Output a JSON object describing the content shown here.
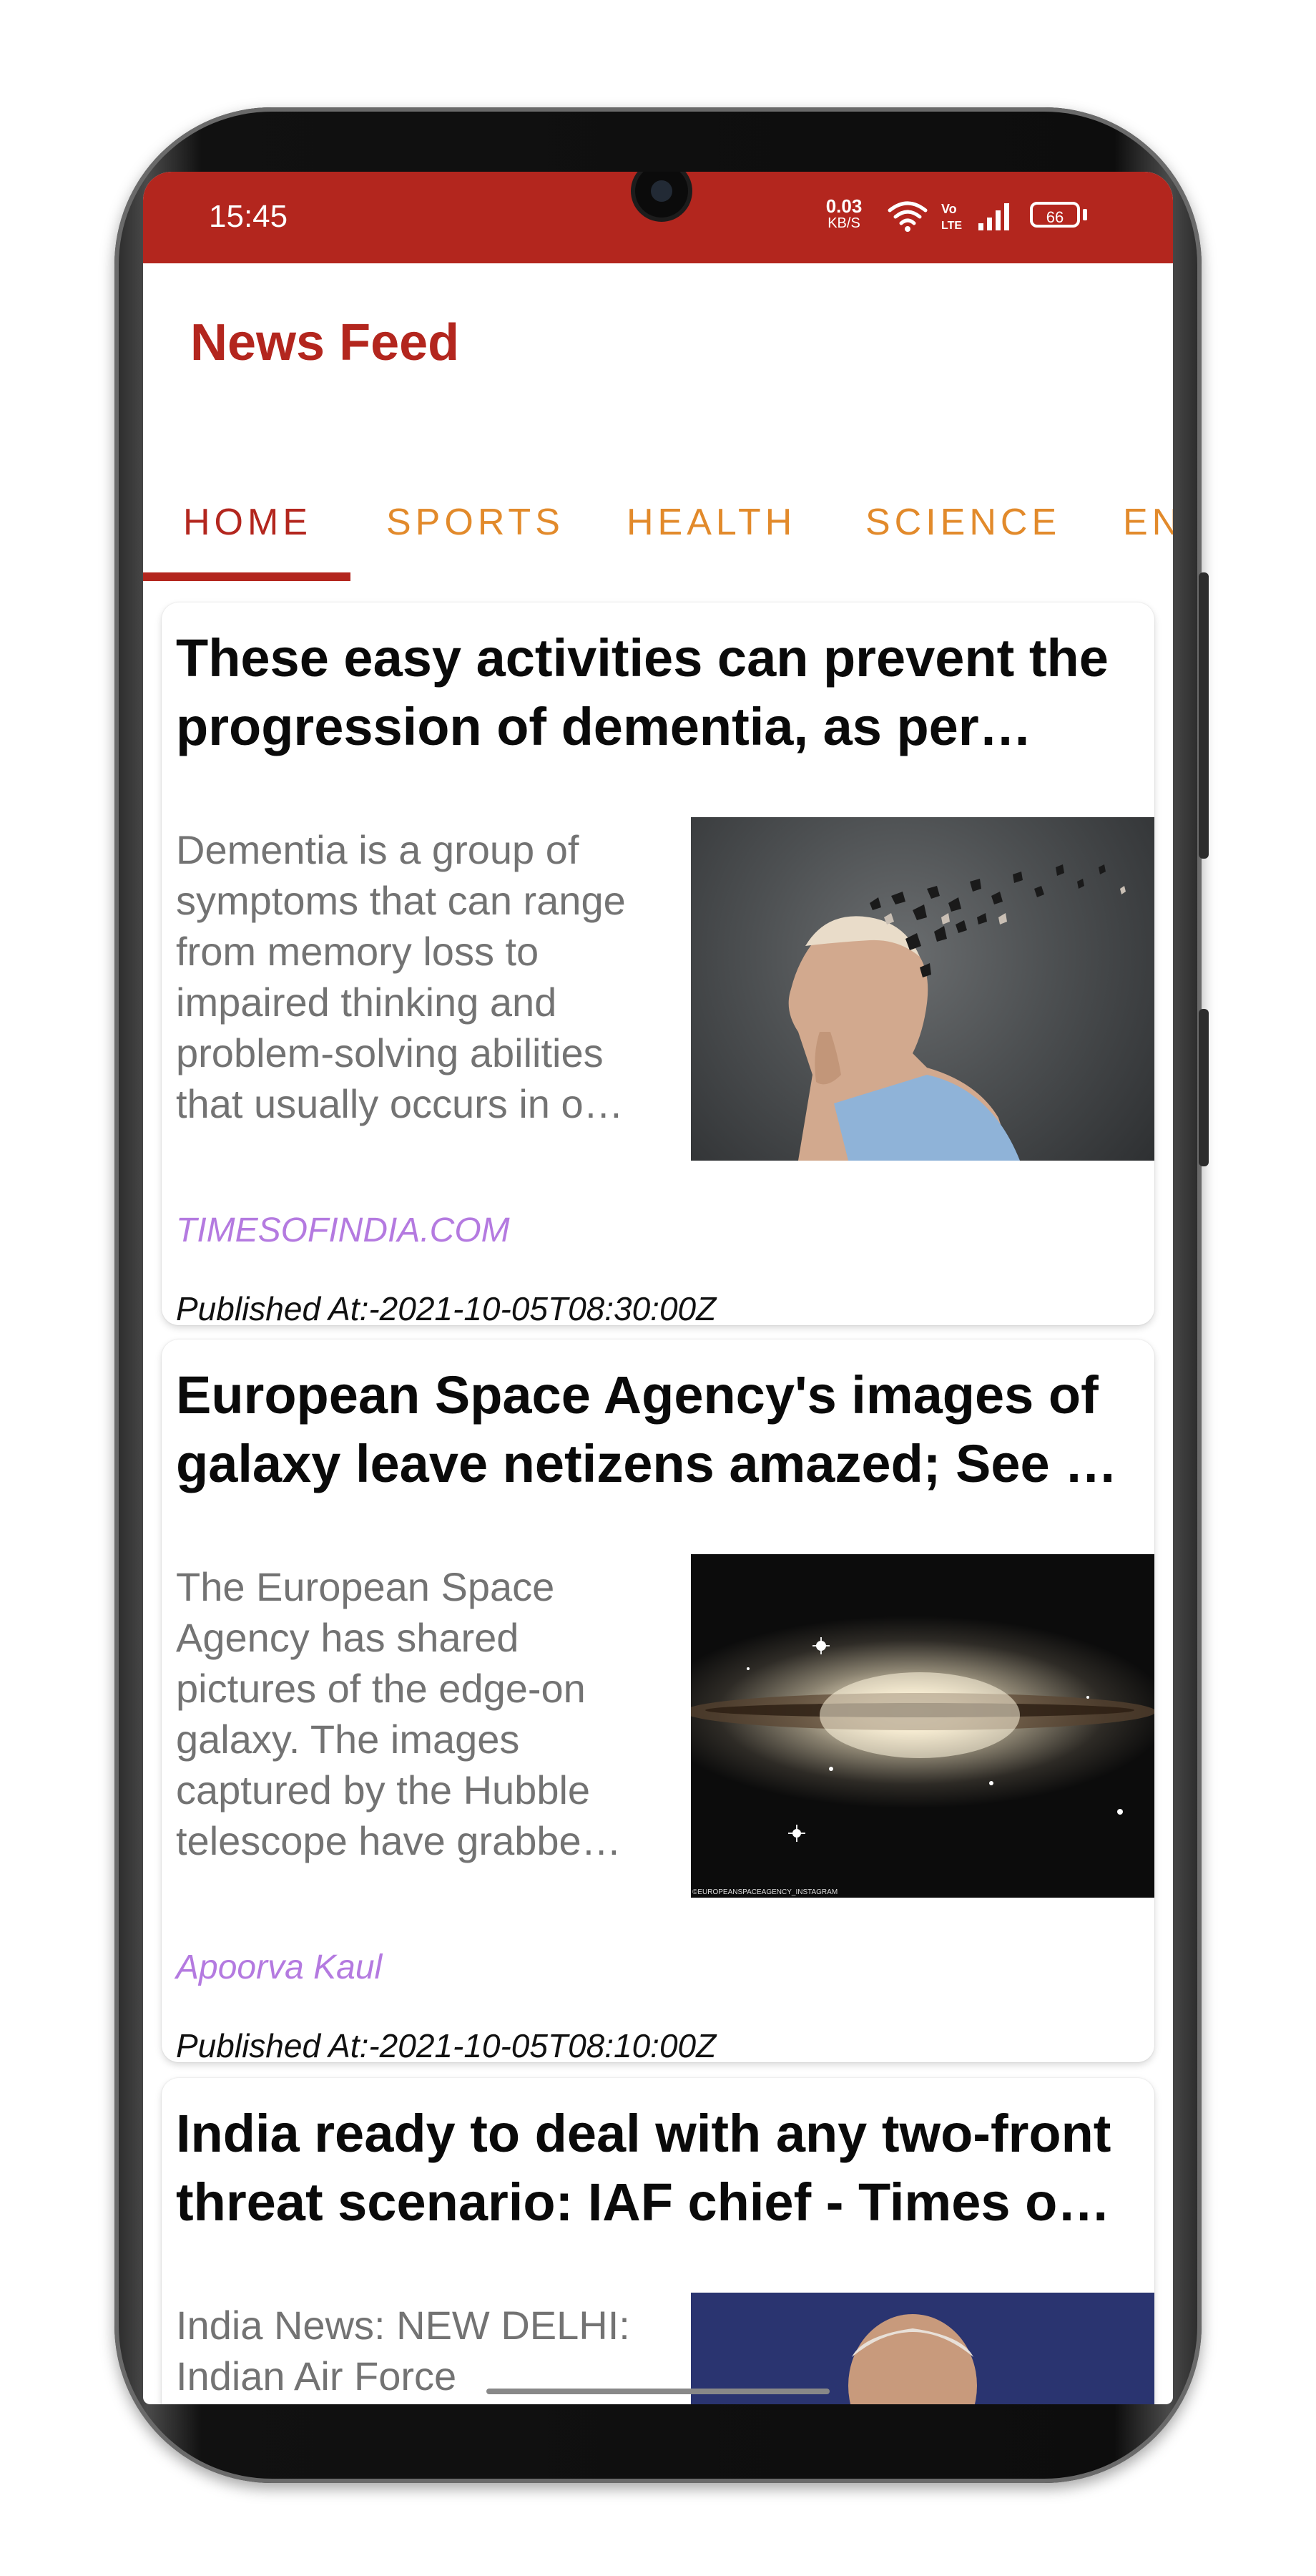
{
  "status_bar": {
    "time": "15:45",
    "net_speed_value": "0.03",
    "net_speed_unit": "KB/S",
    "volte_label": "Vo LTE",
    "battery": "66",
    "icons": [
      "wifi-icon",
      "volte-icon",
      "signal-icon",
      "battery-icon"
    ]
  },
  "app": {
    "title": "News Feed"
  },
  "tabs": [
    {
      "label": "HOME",
      "active": true
    },
    {
      "label": "SPORTS",
      "active": false
    },
    {
      "label": "HEALTH",
      "active": false
    },
    {
      "label": "SCIENCE",
      "active": false
    },
    {
      "label": "EN",
      "active": false
    }
  ],
  "articles": [
    {
      "title": "These easy activities can prevent the progression of dementia, as per…",
      "description": "Dementia is a group of symptoms that can range from memory loss to impaired thinking and problem-solving abilities that usually occurs in o…",
      "source": "TIMESOFINDIA.COM",
      "published": "Published At:-2021-10-05T08:30:00Z",
      "image": "dementia-illustration"
    },
    {
      "title": "European Space Agency's images of galaxy leave netizens amazed; See …",
      "description": "The European Space Agency has shared pictures of the edge-on galaxy. The images captured by the Hubble telescope have grabbe…",
      "source": "Apoorva Kaul",
      "published": "Published At:-2021-10-05T08:10:00Z",
      "image": "galaxy-photo",
      "image_caption": "©EUROPEANSPACEAGENCY_INSTAGRAM"
    },
    {
      "title": "India ready to deal with any two-front threat scenario: IAF chief - Times o…",
      "description": "India News: NEW DELHI: Indian Air Force",
      "image": "iaf-chief-photo"
    }
  ],
  "colors": {
    "primary": "#b3261e",
    "tab_inactive": "#e28a2b",
    "source_text": "#b47ae0",
    "description_text": "#737373"
  }
}
